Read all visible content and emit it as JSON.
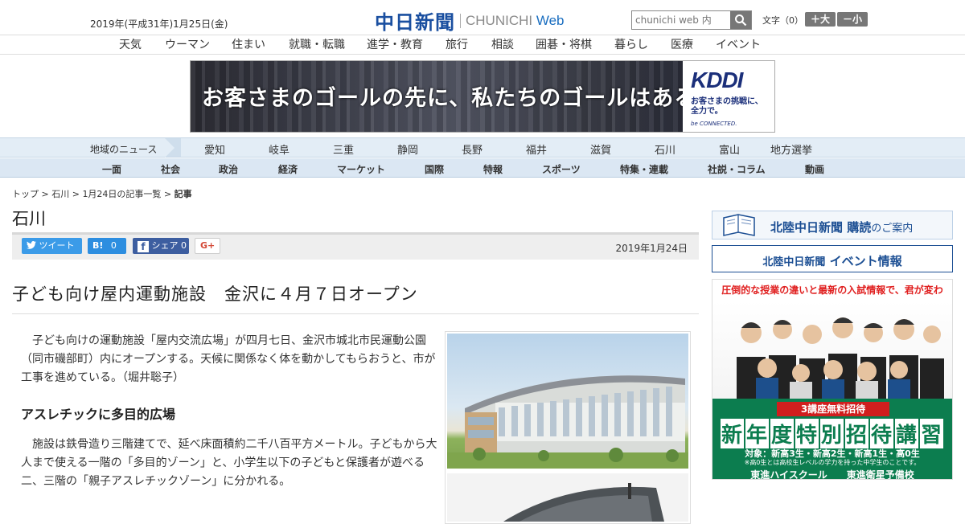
{
  "header": {
    "date": "2019年(平成31年)1月25日(金)",
    "logo_ja": "中日新聞",
    "logo_en_main": "CHUNICHI",
    "logo_en_web": "Web",
    "search_placeholder": "chunichi web 内",
    "font_size_label": "文字（0）",
    "font_up": "＋大",
    "font_down": "－小"
  },
  "genre_nav": [
    "天気",
    "ウーマン",
    "住まい",
    "就職・転職",
    "進学・教育",
    "旅行",
    "相談",
    "囲碁・将棋",
    "暮らし",
    "医療",
    "イベント"
  ],
  "ad": {
    "copy": "お客さまのゴールの先に、私たちのゴールはある。",
    "brand": "KDDI",
    "tagline_1": "お客さまの挑戦に、",
    "tagline_2": "全力で。",
    "tagline_3": "be CONNECTED."
  },
  "region_nav": {
    "label": "地域のニュース",
    "items": [
      "愛知",
      "岐阜",
      "三重",
      "静岡",
      "長野",
      "福井",
      "滋賀",
      "石川",
      "富山",
      "地方選挙"
    ]
  },
  "category_nav": [
    "一面",
    "社会",
    "政治",
    "経済",
    "マーケット",
    "国際",
    "特報",
    "スポーツ",
    "特集・連載",
    "社説・コラム",
    "動画"
  ],
  "breadcrumb": {
    "top": "トップ",
    "region": "石川",
    "list": "1月24日の記事一覧",
    "current": "記事",
    "sep": ">"
  },
  "page_title": "石川",
  "share": {
    "tweet": "ツイート",
    "hatena_count": "0",
    "fb_label": "シェア",
    "fb_count": "0",
    "gplus": "G+",
    "date": "2019年1月24日"
  },
  "article": {
    "headline": "子ども向け屋内運動施設　金沢に４月７日オープン",
    "lead": "子ども向けの運動施設「屋内交流広場」が四月七日、金沢市城北市民運動公園（同市磯部町）内にオープンする。天候に関係なく体を動かしてもらおうと、市が工事を進めている。（堀井聡子）",
    "subhead": "アスレチックに多目的広場",
    "para2": "施設は鉄骨造り三階建てで、延べ床面積約二千八百平方メートル。子どもから大人まで使える一階の「多目的ゾーン」と、小学生以下の子どもと保護者が遊べる二、三階の「親子アスレチックゾーン」に分かれる。"
  },
  "sidebar": {
    "subscribe_main": "北陸中日新聞",
    "subscribe_bold": "購読",
    "subscribe_tail": "のご案内",
    "event_main": "北陸中日新聞",
    "event_tail": "イベント情報",
    "ad_top": "圧倒的な授業の違いと最新の入試情報で、君が変わる。",
    "ad_red": "3講座無料招待",
    "ad_big": [
      "新",
      "年",
      "度",
      "特",
      "別",
      "招",
      "待",
      "講",
      "習"
    ],
    "ad_target": "対象：新高3生・新高2生・新高1生・高0生",
    "ad_note": "※高0生とは高校生レベルの学力を持った中学生のことです。",
    "ad_school": "東進ハイスクール　　東進衛星予備校"
  },
  "colors": {
    "brand_blue": "#1a4fa0",
    "nav_bg": "#e3edf6",
    "twitter": "#3b9be8",
    "facebook": "#3d5ea0",
    "ad_green": "#0c7d4f"
  }
}
